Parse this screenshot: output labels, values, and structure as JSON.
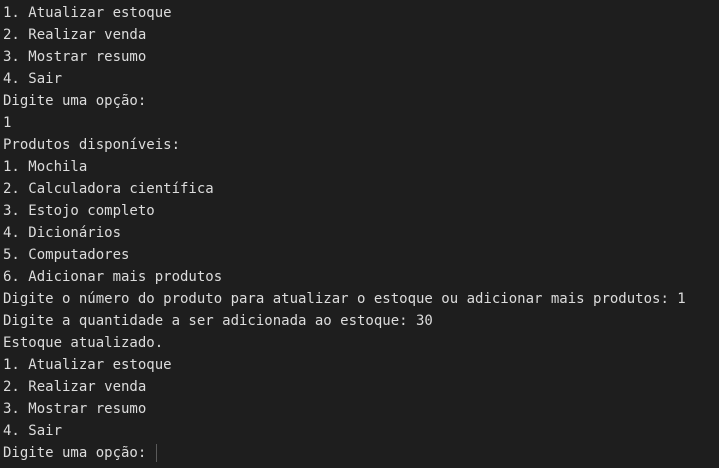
{
  "terminal": {
    "lines": [
      "1. Atualizar estoque",
      "2. Realizar venda",
      "3. Mostrar resumo",
      "4. Sair",
      "Digite uma opção:",
      "1",
      "Produtos disponíveis:",
      "1. Mochila",
      "2. Calculadora científica",
      "3. Estojo completo",
      "4. Dicionários",
      "5. Computadores",
      "6. Adicionar mais produtos",
      "Digite o número do produto para atualizar o estoque ou adicionar mais produtos: 1",
      "Digite a quantidade a ser adicionada ao estoque: 30",
      "Estoque atualizado.",
      "1. Atualizar estoque",
      "2. Realizar venda",
      "3. Mostrar resumo",
      "4. Sair"
    ],
    "prompt": "Digite uma opção: "
  }
}
